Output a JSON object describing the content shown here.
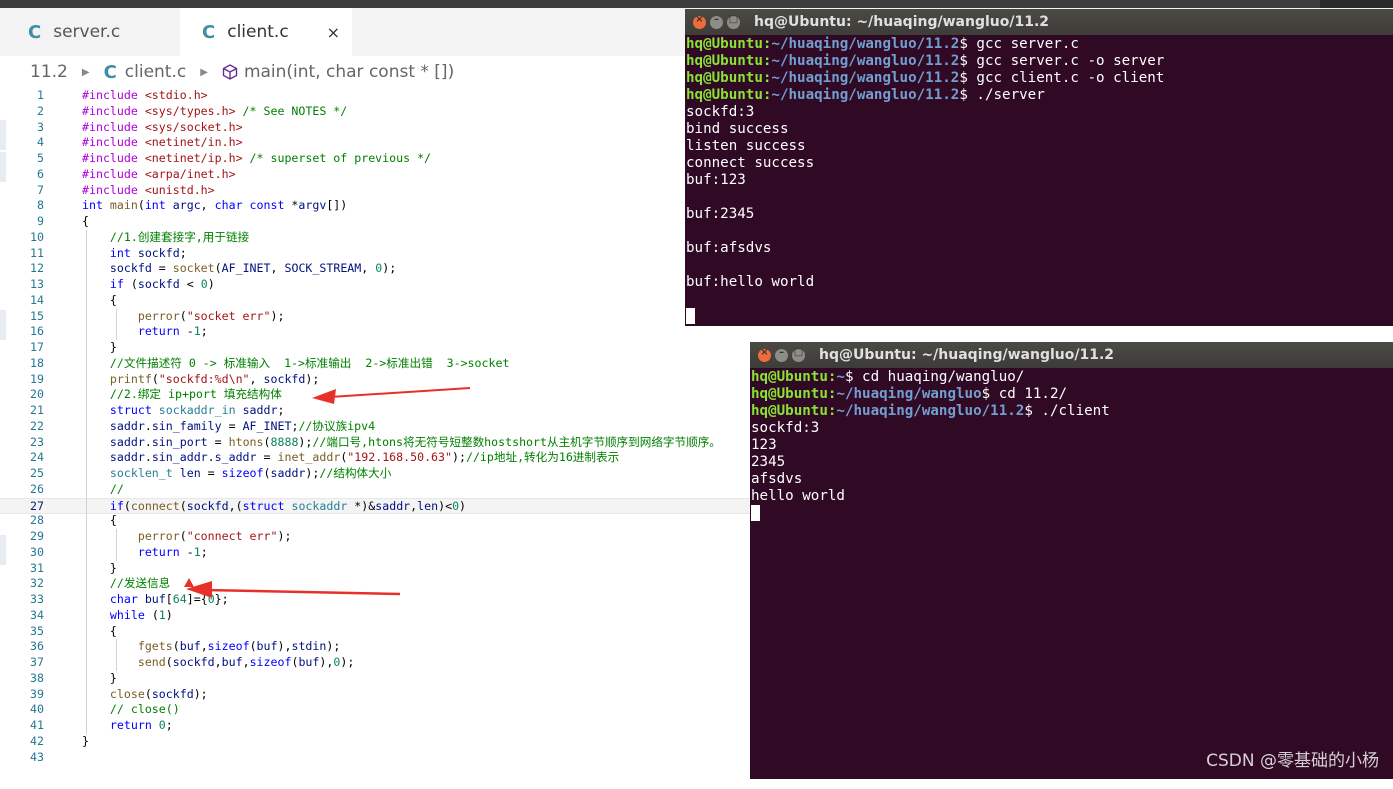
{
  "editor": {
    "tabs": [
      {
        "label": "server.c",
        "icon": "C"
      },
      {
        "label": "client.c",
        "icon": "C",
        "close": "×"
      }
    ],
    "breadcrumb": {
      "folder": "11.2",
      "file": "client.c",
      "icon": "C",
      "symbol": "main(int, char const * [])"
    },
    "line_numbers": [
      "1",
      "2",
      "3",
      "4",
      "5",
      "6",
      "7",
      "8",
      "9",
      "10",
      "11",
      "12",
      "13",
      "14",
      "15",
      "16",
      "17",
      "18",
      "19",
      "20",
      "21",
      "22",
      "23",
      "24",
      "25",
      "26",
      "27",
      "28",
      "29",
      "30",
      "31",
      "32",
      "33",
      "34",
      "35",
      "36",
      "37",
      "38",
      "39",
      "40",
      "41",
      "42",
      "43"
    ],
    "code": [
      [
        [
          "pp",
          "#include "
        ],
        [
          "str",
          "<stdio.h>"
        ]
      ],
      [
        [
          "pp",
          "#include "
        ],
        [
          "str",
          "<sys/types.h>"
        ],
        [
          "cm",
          " /* See NOTES */"
        ]
      ],
      [
        [
          "pp",
          "#include "
        ],
        [
          "str",
          "<sys/socket.h>"
        ]
      ],
      [
        [
          "pp",
          "#include "
        ],
        [
          "str",
          "<netinet/in.h>"
        ]
      ],
      [
        [
          "pp",
          "#include "
        ],
        [
          "str",
          "<netinet/ip.h>"
        ],
        [
          "cm",
          " /* superset of previous */"
        ]
      ],
      [
        [
          "pp",
          "#include "
        ],
        [
          "str",
          "<arpa/inet.h>"
        ]
      ],
      [
        [
          "pp",
          "#include "
        ],
        [
          "str",
          "<unistd.h>"
        ]
      ],
      [
        [
          "kw",
          "int "
        ],
        [
          "fn",
          "main"
        ],
        [
          "",
          "("
        ],
        [
          "kw",
          "int "
        ],
        [
          "var",
          "argc"
        ],
        [
          "",
          ", "
        ],
        [
          "kw",
          "char const "
        ],
        [
          "",
          "*"
        ],
        [
          "var",
          "argv"
        ],
        [
          "",
          "[])"
        ]
      ],
      [
        [
          "",
          "{"
        ]
      ],
      [
        [
          "",
          "    "
        ],
        [
          "cm",
          "//1.创建套接字,用于链接"
        ]
      ],
      [
        [
          "",
          "    "
        ],
        [
          "kw",
          "int "
        ],
        [
          "var",
          "sockfd"
        ],
        [
          "",
          ";"
        ]
      ],
      [
        [
          "",
          "    "
        ],
        [
          "var",
          "sockfd"
        ],
        [
          "",
          " = "
        ],
        [
          "fn",
          "socket"
        ],
        [
          "",
          "("
        ],
        [
          "var",
          "AF_INET"
        ],
        [
          "",
          ", "
        ],
        [
          "var",
          "SOCK_STREAM"
        ],
        [
          "",
          ", "
        ],
        [
          "num",
          "0"
        ],
        [
          "",
          ");"
        ]
      ],
      [
        [
          "",
          "    "
        ],
        [
          "kw",
          "if "
        ],
        [
          "",
          "("
        ],
        [
          "var",
          "sockfd"
        ],
        [
          "",
          " < "
        ],
        [
          "num",
          "0"
        ],
        [
          "",
          ")"
        ]
      ],
      [
        [
          "",
          "    {"
        ]
      ],
      [
        [
          "",
          "        "
        ],
        [
          "fn",
          "perror"
        ],
        [
          "",
          "("
        ],
        [
          "str",
          "\"socket err\""
        ],
        [
          "",
          ");"
        ]
      ],
      [
        [
          "",
          "        "
        ],
        [
          "kw",
          "return "
        ],
        [
          "",
          "-"
        ],
        [
          "num",
          "1"
        ],
        [
          "",
          ";"
        ]
      ],
      [
        [
          "",
          "    }"
        ]
      ],
      [
        [
          "",
          "    "
        ],
        [
          "cm",
          "//文件描述符 0 -> 标准输入  1->标准输出  2->标准出错  3->socket"
        ]
      ],
      [
        [
          "",
          "    "
        ],
        [
          "fn",
          "printf"
        ],
        [
          "",
          "("
        ],
        [
          "str",
          "\"sockfd:%d\\n\""
        ],
        [
          "",
          ", "
        ],
        [
          "var",
          "sockfd"
        ],
        [
          "",
          ");"
        ]
      ],
      [
        [
          "",
          "    "
        ],
        [
          "cm",
          "//2.绑定 ip+port 填充结构体"
        ]
      ],
      [
        [
          "",
          "    "
        ],
        [
          "kw",
          "struct "
        ],
        [
          "ty",
          "sockaddr_in "
        ],
        [
          "var",
          "saddr"
        ],
        [
          "",
          ";"
        ]
      ],
      [
        [
          "",
          "    "
        ],
        [
          "var",
          "saddr"
        ],
        [
          "",
          "."
        ],
        [
          "var",
          "sin_family"
        ],
        [
          "",
          " = "
        ],
        [
          "var",
          "AF_INET"
        ],
        [
          "",
          ";"
        ],
        [
          "cm",
          "//协议族ipv4"
        ]
      ],
      [
        [
          "",
          "    "
        ],
        [
          "var",
          "saddr"
        ],
        [
          "",
          "."
        ],
        [
          "var",
          "sin_port"
        ],
        [
          "",
          " = "
        ],
        [
          "fn",
          "htons"
        ],
        [
          "",
          "("
        ],
        [
          "num",
          "8888"
        ],
        [
          "",
          ");"
        ],
        [
          "cm",
          "//端口号,htons将无符号短整数hostshort从主机字节顺序到网络字节顺序。"
        ]
      ],
      [
        [
          "",
          "    "
        ],
        [
          "var",
          "saddr"
        ],
        [
          "",
          "."
        ],
        [
          "var",
          "sin_addr"
        ],
        [
          "",
          "."
        ],
        [
          "var",
          "s_addr"
        ],
        [
          "",
          " = "
        ],
        [
          "fn",
          "inet_addr"
        ],
        [
          "",
          "("
        ],
        [
          "str",
          "\"192.168.50.63\""
        ],
        [
          "",
          ");"
        ],
        [
          "cm",
          "//ip地址,转化为16进制表示"
        ]
      ],
      [
        [
          "",
          "    "
        ],
        [
          "ty",
          "socklen_t "
        ],
        [
          "var",
          "len"
        ],
        [
          "",
          " = "
        ],
        [
          "kw",
          "sizeof"
        ],
        [
          "",
          "("
        ],
        [
          "var",
          "saddr"
        ],
        [
          "",
          ");"
        ],
        [
          "cm",
          "//结构体大小"
        ]
      ],
      [
        [
          "",
          "    "
        ],
        [
          "cm",
          "//"
        ]
      ],
      [
        [
          "",
          "    "
        ],
        [
          "kw",
          "if"
        ],
        [
          "",
          "("
        ],
        [
          "fn",
          "connect"
        ],
        [
          "",
          "("
        ],
        [
          "var",
          "sockfd"
        ],
        [
          "",
          ",("
        ],
        [
          "kw",
          "struct "
        ],
        [
          "ty",
          "sockaddr "
        ],
        [
          "",
          "*)&"
        ],
        [
          "var",
          "saddr"
        ],
        [
          "",
          ","
        ],
        [
          "var",
          "len"
        ],
        [
          "",
          ")<"
        ],
        [
          "num",
          "0"
        ],
        [
          "",
          ")"
        ]
      ],
      [
        [
          "",
          "    {"
        ]
      ],
      [
        [
          "",
          "        "
        ],
        [
          "fn",
          "perror"
        ],
        [
          "",
          "("
        ],
        [
          "str",
          "\"connect err\""
        ],
        [
          "",
          ");"
        ]
      ],
      [
        [
          "",
          "        "
        ],
        [
          "kw",
          "return "
        ],
        [
          "",
          "-"
        ],
        [
          "num",
          "1"
        ],
        [
          "",
          ";"
        ]
      ],
      [
        [
          "",
          "    }"
        ]
      ],
      [
        [
          "",
          "    "
        ],
        [
          "cm",
          "//发送信息"
        ]
      ],
      [
        [
          "",
          "    "
        ],
        [
          "kw",
          "char "
        ],
        [
          "var",
          "buf"
        ],
        [
          "",
          "["
        ],
        [
          "num",
          "64"
        ],
        [
          "",
          "]={"
        ],
        [
          "num",
          "0"
        ],
        [
          "",
          "};"
        ]
      ],
      [
        [
          "",
          "    "
        ],
        [
          "kw",
          "while "
        ],
        [
          "",
          "("
        ],
        [
          "num",
          "1"
        ],
        [
          "",
          ")"
        ]
      ],
      [
        [
          "",
          "    {"
        ]
      ],
      [
        [
          "",
          "        "
        ],
        [
          "fn",
          "fgets"
        ],
        [
          "",
          "("
        ],
        [
          "var",
          "buf"
        ],
        [
          "",
          ","
        ],
        [
          "kw",
          "sizeof"
        ],
        [
          "",
          "("
        ],
        [
          "var",
          "buf"
        ],
        [
          "",
          "),"
        ],
        [
          "var",
          "stdin"
        ],
        [
          "",
          ");"
        ]
      ],
      [
        [
          "",
          "        "
        ],
        [
          "fn",
          "send"
        ],
        [
          "",
          "("
        ],
        [
          "var",
          "sockfd"
        ],
        [
          "",
          ","
        ],
        [
          "var",
          "buf"
        ],
        [
          "",
          ","
        ],
        [
          "kw",
          "sizeof"
        ],
        [
          "",
          "("
        ],
        [
          "var",
          "buf"
        ],
        [
          "",
          "),"
        ],
        [
          "num",
          "0"
        ],
        [
          "",
          ");"
        ]
      ],
      [
        [
          "",
          "    }"
        ]
      ],
      [
        [
          "",
          "    "
        ],
        [
          "fn",
          "close"
        ],
        [
          "",
          "("
        ],
        [
          "var",
          "sockfd"
        ],
        [
          "",
          ");"
        ]
      ],
      [
        [
          "",
          "    "
        ],
        [
          "cm",
          "// close()"
        ]
      ],
      [
        [
          "",
          "    "
        ],
        [
          "kw",
          "return "
        ],
        [
          "num",
          "0"
        ],
        [
          "",
          ";"
        ]
      ],
      [
        [
          "",
          "}"
        ]
      ],
      [
        [
          "",
          ""
        ]
      ]
    ],
    "current_line": 27
  },
  "terminal_server": {
    "title": "hq@Ubuntu: ~/huaqing/wangluo/11.2",
    "buttons": {
      "close": "×",
      "min": "–",
      "max": "□"
    },
    "lines": [
      {
        "user": "hq@Ubuntu",
        "path": "~/huaqing/wangluo/11.2",
        "cmd": "$ gcc server.c"
      },
      {
        "user": "hq@Ubuntu",
        "path": "~/huaqing/wangluo/11.2",
        "cmd": "$ gcc server.c -o server"
      },
      {
        "user": "hq@Ubuntu",
        "path": "~/huaqing/wangluo/11.2",
        "cmd": "$ gcc client.c -o client"
      },
      {
        "user": "hq@Ubuntu",
        "path": "~/huaqing/wangluo/11.2",
        "cmd": "$ ./server"
      },
      {
        "text": "sockfd:3"
      },
      {
        "text": "bind success"
      },
      {
        "text": "listen success"
      },
      {
        "text": "connect success"
      },
      {
        "text": "buf:123"
      },
      {
        "text": ""
      },
      {
        "text": "buf:2345"
      },
      {
        "text": ""
      },
      {
        "text": "buf:afsdvs"
      },
      {
        "text": ""
      },
      {
        "text": "buf:hello world"
      },
      {
        "text": ""
      },
      {
        "cursor": true
      }
    ]
  },
  "terminal_client": {
    "title": "hq@Ubuntu: ~/huaqing/wangluo/11.2",
    "buttons": {
      "close": "×",
      "min": "–",
      "max": "□"
    },
    "lines": [
      {
        "user": "hq@Ubuntu",
        "path": "~",
        "cmd": "$ cd huaqing/wangluo/"
      },
      {
        "user": "hq@Ubuntu",
        "path": "~/huaqing/wangluo",
        "cmd": "$ cd 11.2/"
      },
      {
        "user": "hq@Ubuntu",
        "path": "~/huaqing/wangluo/11.2",
        "cmd": "$ ./client"
      },
      {
        "text": "sockfd:3"
      },
      {
        "text": "123"
      },
      {
        "text": "2345"
      },
      {
        "text": "afsdvs"
      },
      {
        "text": "hello world"
      },
      {
        "cursor": true
      }
    ]
  },
  "watermark": "CSDN @零基础的小杨",
  "colors": {
    "terminal_bg": "#300a24",
    "prompt_user": "#8ae234",
    "prompt_path": "#729fcf",
    "annotation_arrow": "#e8302a"
  }
}
